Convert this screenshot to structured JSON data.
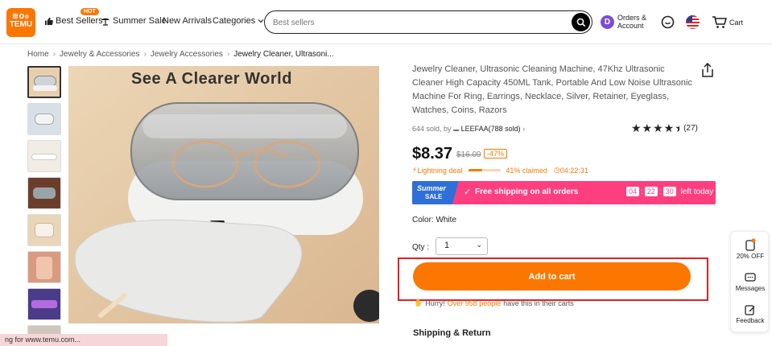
{
  "header": {
    "logo_line1": "ꕥ𝐎𐍈",
    "logo_line2": "TEMU",
    "nav": {
      "best_sellers": "Best Sellers",
      "hot": "HOT",
      "summer_sale": "Summer Sale",
      "new_arrivals": "New Arrivals",
      "categories": "Categories"
    },
    "search_placeholder": "Best sellers",
    "account_initial": "D",
    "account_line1": "Orders &",
    "account_line2": "Account",
    "cart": "Cart",
    "colors": {
      "brand": "#fb7701",
      "avatar": "#7b4fd0"
    }
  },
  "breadcrumb": [
    "Home",
    "Jewelry & Accessories",
    "Jewelry Accessories",
    "Jewelry Cleaner, Ultrasoni..."
  ],
  "main_image": {
    "title": "See A Clearer World"
  },
  "product": {
    "title": "Jewelry Cleaner, Ultrasonic Cleaning Machine, 47Khz Ultrasonic Cleaner High Capacity 450ML Tank, Portable And Low Noise Ultrasonic Machine For Ring, Earrings, Necklace, Silver, Retainer, Eyeglass, Watches, Coins, Razors",
    "sold": "644 sold, by",
    "store": "LEEFAA(788 sold)",
    "rating_count": "(27)",
    "rating": 4.5,
    "price": "$8.37",
    "original_price": "$16.09",
    "discount": "-47%",
    "lightning_label": "Lightning deal",
    "claimed": "41% claimed",
    "claimed_fraction": 0.41,
    "deal_timer": "04:22:31",
    "promo": {
      "logo_top": "Summer",
      "logo_bottom": "SALE",
      "free_shipping": "Free shipping on all orders",
      "timer": [
        "04",
        "22",
        "30"
      ],
      "timer_suffix": "left today"
    },
    "color_label": "Color: White",
    "qty_label": "Qty :",
    "qty_value": "1",
    "add_to_cart": "Add to cart",
    "hurry_prefix": "Hurry!",
    "hurry_count": "Over 958 people",
    "hurry_suffix": "have this in their carts",
    "shipping_return": "Shipping & Return"
  },
  "float_bar": {
    "off": "20% OFF",
    "messages": "Messages",
    "feedback": "Feedback"
  },
  "status_bar": "ng for www.temu.com..."
}
